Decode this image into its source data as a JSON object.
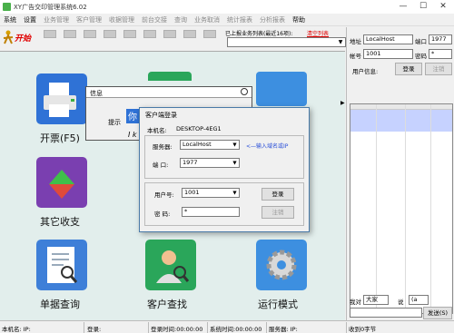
{
  "title_bar": {
    "title": "XY广告交印管理系统6.02",
    "minimize": "—",
    "maximize": "☐",
    "close": "✕"
  },
  "menu": {
    "items": [
      "系统",
      "设置",
      "业务管理",
      "客户管理",
      "收据管理",
      "前台交接",
      "查询",
      "业务取消",
      "统计报表",
      "分析报表",
      "帮助"
    ],
    "disabled": [
      false,
      false,
      true,
      true,
      true,
      true,
      true,
      true,
      true,
      true,
      false
    ]
  },
  "toolbar": {
    "start_label": "开始",
    "reported_label": "已上报业务列表(最近16项):",
    "clear_label": "清空列表"
  },
  "modules": [
    {
      "key": "issue",
      "label": "开票(F5)",
      "color": "#2f72d6",
      "icon": "printer-icon"
    },
    {
      "key": "other",
      "label": "其它收支",
      "color": "#7a3fb0",
      "icon": "transfer-icon"
    },
    {
      "key": "receipt",
      "label": "单据查询",
      "color": "#3e7fd8",
      "icon": "document-search-icon"
    },
    {
      "key": "customer",
      "label": "客户查找",
      "color": "#2aa65a",
      "icon": "customer-icon"
    },
    {
      "key": "mode",
      "label": "运行模式",
      "color": "#3d8fe0",
      "icon": "gear-icon"
    }
  ],
  "info_dialog": {
    "title": "信息",
    "prompt": "提示",
    "heading": "你",
    "line": "I k"
  },
  "login_dialog": {
    "title": "客户端登录",
    "machine_label": "本机名:",
    "machine_name": "DESKTOP-4EG1",
    "server_label": "服务器:",
    "server_value": "LocalHost",
    "hint": "<—输入域名或IP",
    "port_label": "端 口:",
    "port_value": "1977",
    "user_label": "用户号:",
    "user_value": "1001",
    "password_label": "密 码:",
    "password_value": "*",
    "login_button": "登录",
    "cancel_button": "注销"
  },
  "right_panel": {
    "address_label": "地址",
    "address_value": "LocalHost",
    "port_label": "端口",
    "port_value": "1977",
    "account_label": "帐号",
    "account_value": "1001",
    "password_label": "密码",
    "password_value": "*",
    "user_info_label": "用户信息:",
    "login_button": "登录",
    "logout_button": "注销",
    "to_label": "我对",
    "to_value": "大家",
    "say_label": "说",
    "say_value": "(a",
    "send_button": "发送(S)"
  },
  "status_bar": {
    "machine": "本机名: IP:",
    "login": "登录:",
    "login_time": "登录时间:00:00:00",
    "system_time": "系统时间:00:00:00",
    "service": "服务器: IP:",
    "received": "收到0字节"
  },
  "colors": {
    "desktop": "#e2eeec",
    "accent": "#2f72d6",
    "clear_link": "#e00000",
    "hint": "#2a4fd8"
  }
}
